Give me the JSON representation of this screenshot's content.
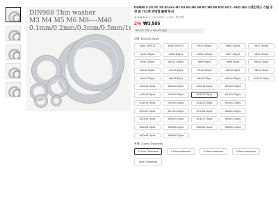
{
  "image": {
    "overlay_lines": [
      "DIN988 Thin washer",
      "M3 M4 M5 M6 M8----M40",
      "0.1mm/0.2mm/0.3mm/0.5mm/1mm"
    ]
  },
  "product": {
    "title": "DIN988 0.1/0.2/0.3/0.5/1mm M2 M3 M4 M5 M6 M7 M8 M9 M10 M12 - M40 304 스테인레스 스틸 조정 링 가스켓 초박형 플랫 와셔",
    "rating": "★★★★★ 4.9 347 리뷰 | 1,000+ 개 판매",
    "discount": "2%",
    "price": "₩3,505",
    "coupon": "₩3,000 구매 시 ₩4,000 할인"
  },
  "size_option": {
    "label": "내경: M12x20 20pcs",
    "items": [
      "M2x5 100PCS",
      "m3x6 100PCS",
      "m3x7 100pcs",
      "m4x8 100pcs",
      "m4x7 100pcs",
      "m4x9 100pcs",
      "m5x8 100pcs",
      "m5x10 100pcs",
      "m5x7 100pcs",
      "m5x9 100pcs",
      "m5x9 100pcs",
      "m6x10 100pcs",
      "mex9 50pcs",
      "mex8 50pcs",
      "mex13 50pcs",
      "m6x12 50pcs",
      "m7x10 50pcs",
      "m7x12 50pcs",
      "m8x10 50pcs",
      "m8x14 50pcs",
      "m8x12 50pcs",
      "m8x13 50pcs",
      "m8x16 50pcs",
      "m10x14 50pcs",
      "m10x12 20pcs",
      "m10x18 20pcs",
      "M10x16 20pcs",
      "M10x18 20pcs",
      "M10x20 20pcs",
      "",
      "m12x16 20pcs",
      "m12x18 20pcs",
      "M12x20 20pcs",
      "M13x19 20pcs",
      "",
      "M14x18 20pcs",
      "m14x20 20pcs",
      "m14x20 20pcs",
      "M14x22 20pcs",
      "",
      "M17x22 20pcs",
      "M17x24 20pcs",
      "M17x28 20pcs",
      "M18x24 20pcs",
      "",
      "M20x28 20pcs",
      "M20x29 20pcs",
      "M14x12 20pcs",
      "M16x12 20pcs",
      "",
      "M22x28 10pcs",
      "M25x28 10pcs",
      "M30x36 10pcs",
      "M35x40 10pcs",
      "",
      "M40x48 10pcs",
      "M38x48 10pcs",
      "",
      "",
      ""
    ],
    "selected_index": 32
  },
  "thickness_option": {
    "label": "두께: 0.1mm Thickness",
    "items": [
      "0.1mm Thickness",
      "0.2mm thickness",
      "0.3mm thickness",
      "0.5mm thickness",
      "1mm Thickness"
    ],
    "selected_index": 0
  }
}
